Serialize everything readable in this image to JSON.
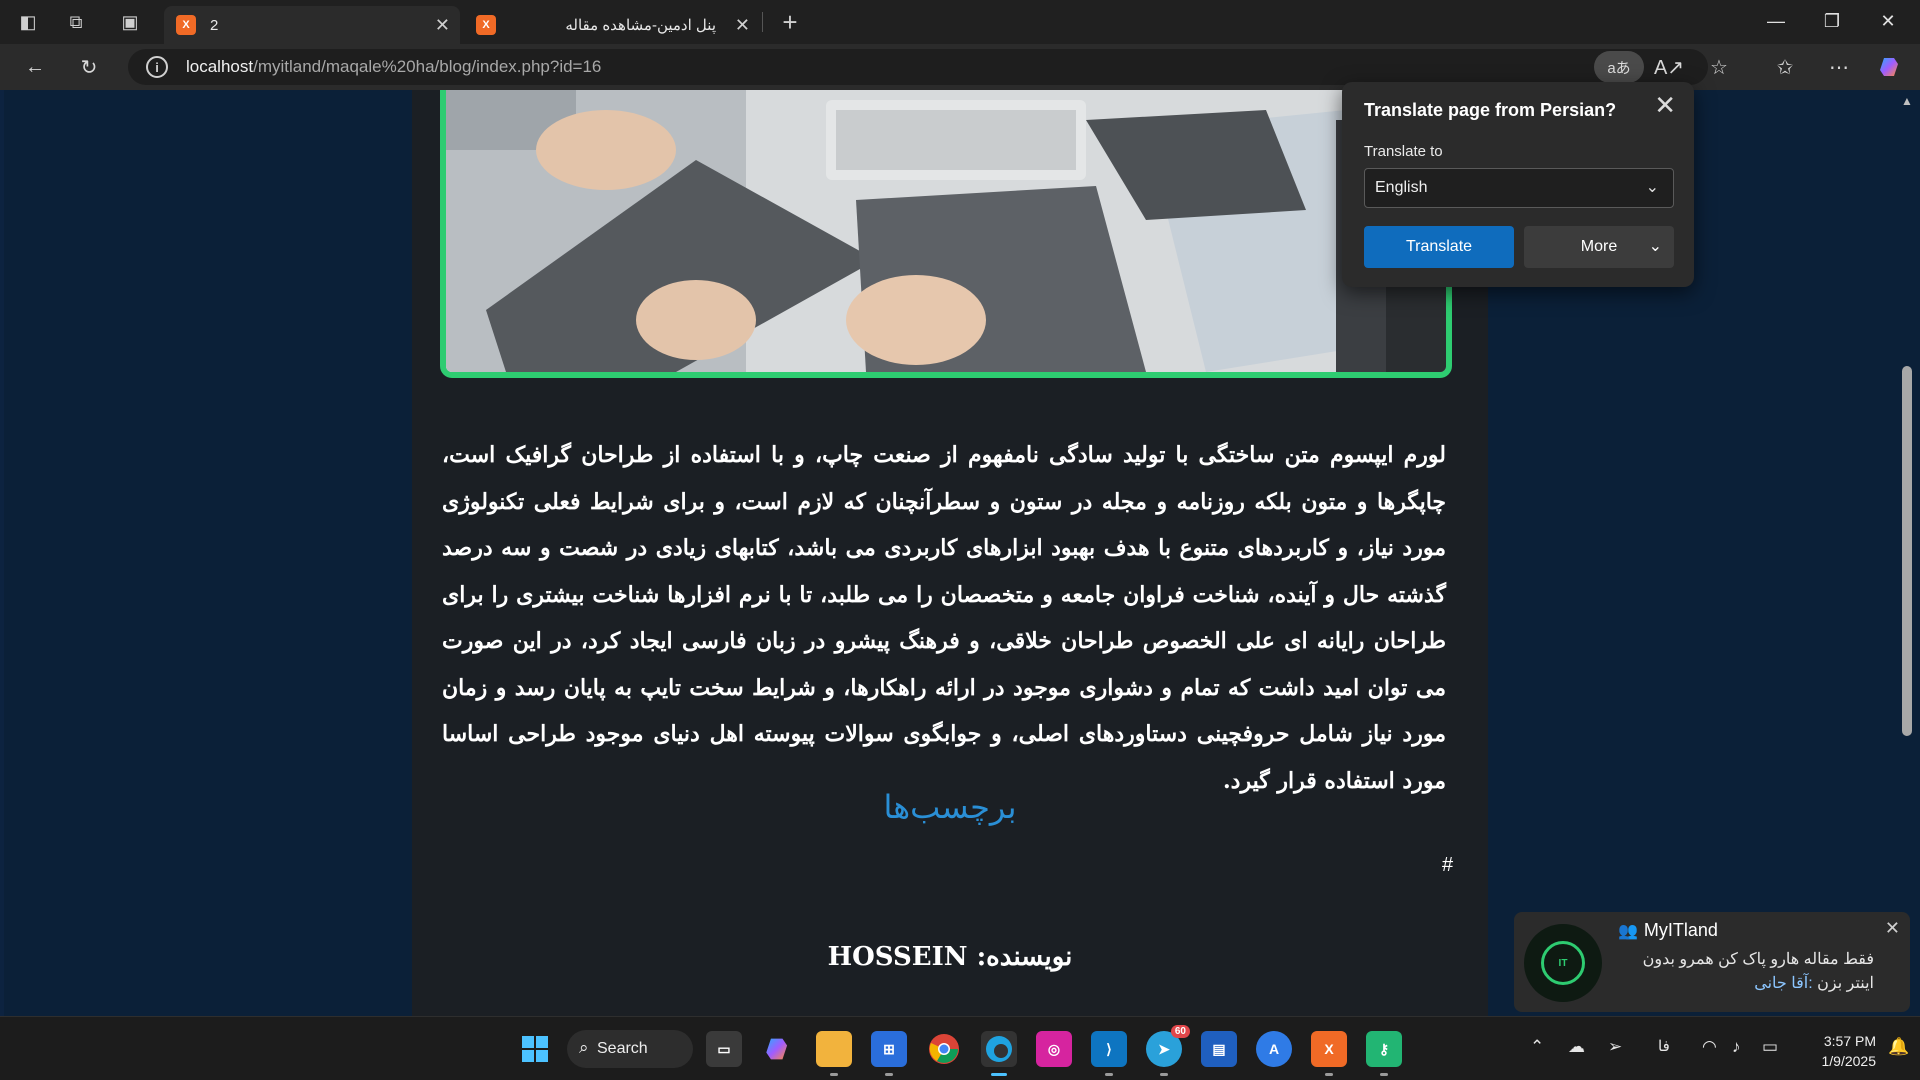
{
  "browser": {
    "tabs": [
      {
        "title": "2",
        "active": true
      },
      {
        "title": "پنل ادمین-مشاهده مقاله",
        "active": false
      }
    ],
    "url_host": "localhost",
    "url_path": "/myitland/maqale%20ha/blog/index.php?id=16",
    "translate_pill": "aあ"
  },
  "article": {
    "body": "لورم ایپسوم متن ساختگی با تولید سادگی نامفهوم از صنعت چاپ، و با استفاده از طراحان گرافیک است، چاپگرها و متون بلکه روزنامه و مجله در ستون و سطرآنچنان که لازم است، و برای شرایط فعلی تکنولوژی مورد نیاز، و کاربردهای متنوع با هدف بهبود ابزارهای کاربردی می باشد، کتابهای زیادی در شصت و سه درصد گذشته حال و آینده، شناخت فراوان جامعه و متخصصان را می طلبد، تا با نرم افزارها شناخت بیشتری را برای طراحان رایانه ای علی الخصوص طراحان خلاقی، و فرهنگ پیشرو در زبان فارسی ایجاد کرد، در این صورت می توان امید داشت که تمام و دشواری موجود در ارائه راهکارها، و شرایط سخت تایپ به پایان رسد و زمان مورد نیاز شامل حروفچینی دستاوردهای اصلی، و جوابگوی سوالات پیوسته اهل دنیای موجود طراحی اساسا مورد استفاده قرار گیرد.",
    "tags_title": "برچسب‌ها",
    "tag": "#",
    "author": "نویسنده: HOSSEIN"
  },
  "translate_popup": {
    "title": "Translate page from Persian?",
    "label": "Translate to",
    "language": "English",
    "translate_button": "Translate",
    "more_button": "More"
  },
  "notification": {
    "app": "MyITland",
    "sender": ":آقا جانی",
    "message": "فقط مقاله هارو پاک کن همرو بدون اینتر بزن",
    "avatar_text": "IT"
  },
  "taskbar": {
    "search_label": "Search",
    "telegram_badge": "60",
    "lang": "فا",
    "time": "3:57 PM",
    "date": "1/9/2025"
  },
  "colors": {
    "hero_border": "#2ecc71",
    "tags_title": "#2a8fd6",
    "translate_button": "#0f6cbd",
    "page_bg": "#0b2038"
  }
}
